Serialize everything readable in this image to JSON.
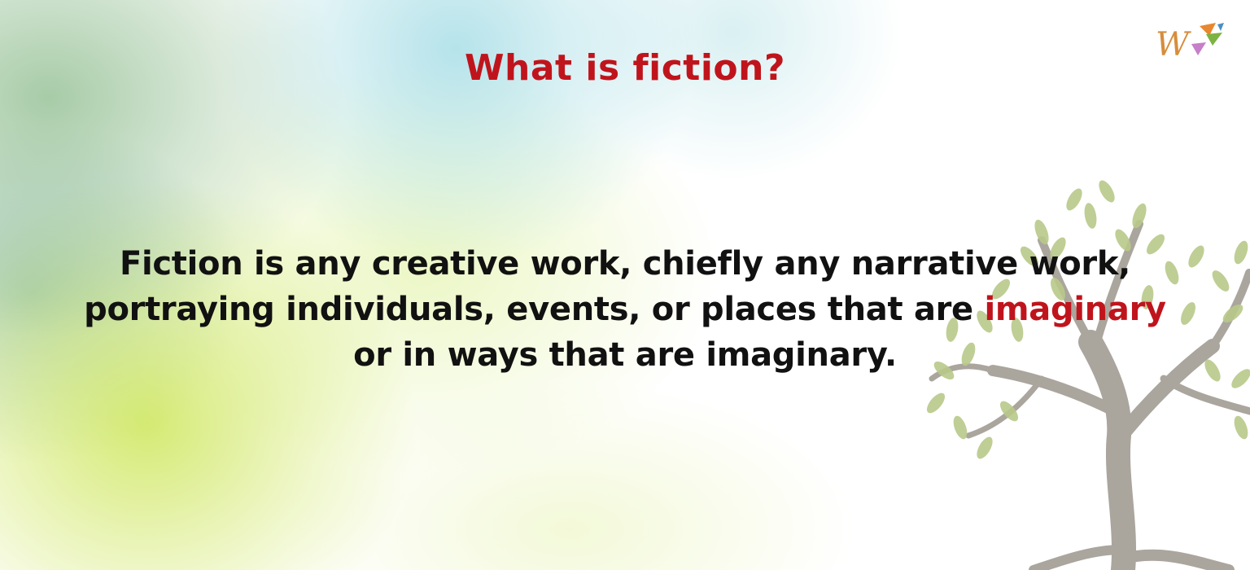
{
  "slide": {
    "title": "What is fiction?",
    "definition": {
      "line1": "Fiction is any creative work, chiefly any narrative work,",
      "line2_before": "portraying individuals, events, or places that are ",
      "line2_highlight": "imaginary",
      "line3": "or in ways that are imaginary."
    }
  },
  "logo": {
    "letter": "W"
  },
  "colors": {
    "title": "#c0141c",
    "highlight": "#c0141c",
    "text": "#111111",
    "leaf": "#b9c98a",
    "trunk": "#aaa59d"
  },
  "icons": [
    "brand-logo-icon",
    "tree-illustration-icon"
  ]
}
